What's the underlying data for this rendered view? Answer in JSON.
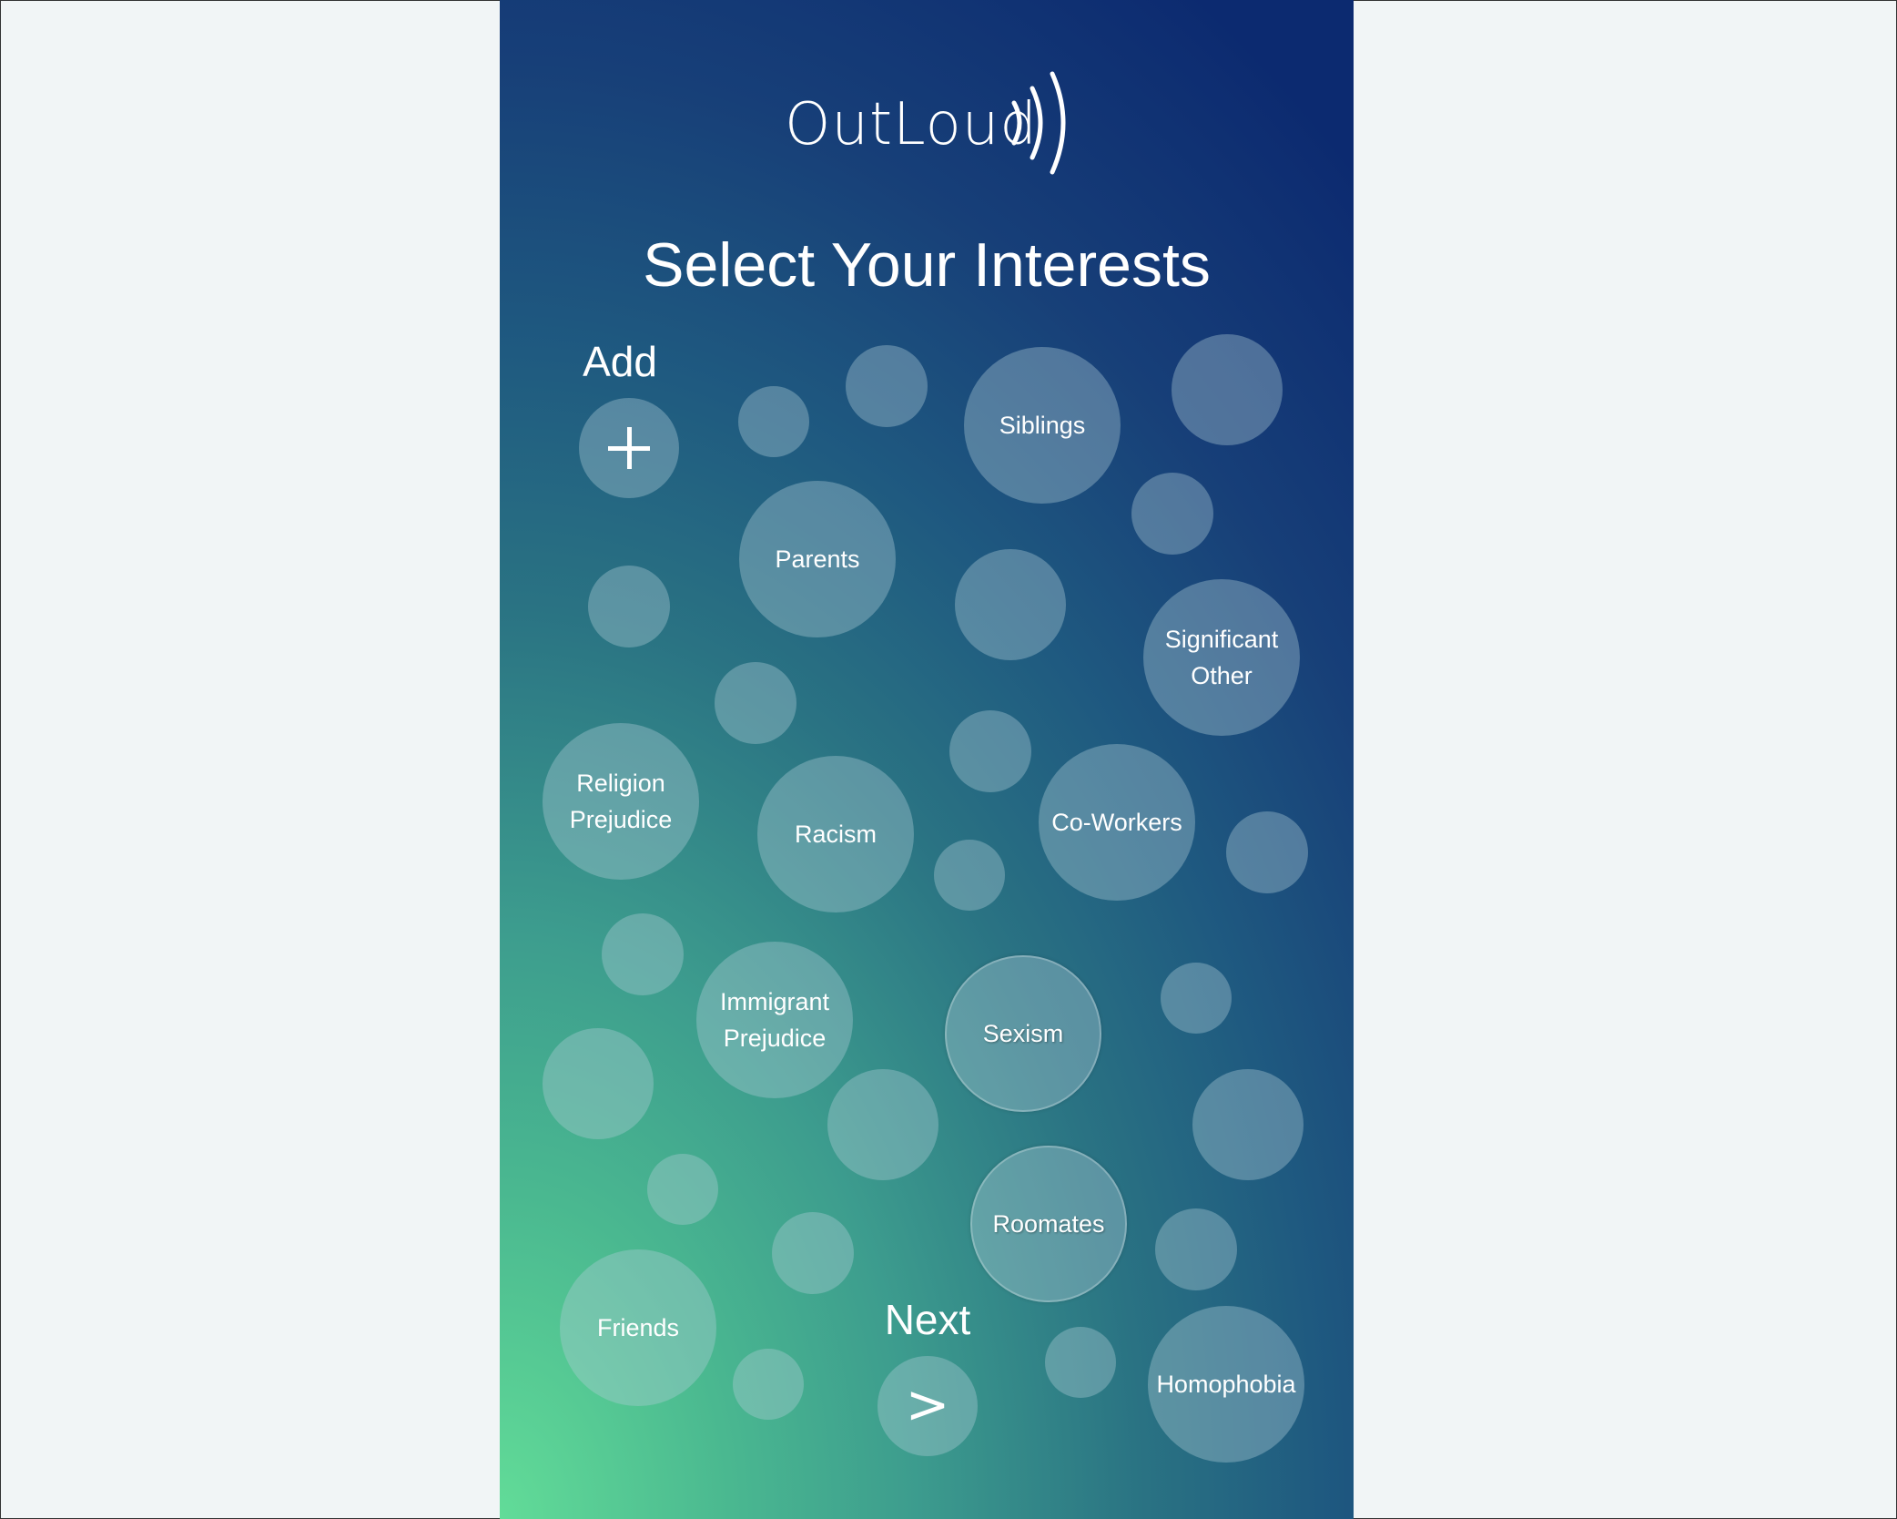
{
  "app": {
    "logo_text": "OutLoud",
    "title": "Select Your Interests"
  },
  "controls": {
    "add_label": "Add",
    "next_label": "Next",
    "next_symbol": ">"
  },
  "interests": {
    "siblings": "Siblings",
    "parents": "Parents",
    "significant_other_1": "Significant",
    "significant_other_2": "Other",
    "religion_1": "Religion",
    "religion_2": "Prejudice",
    "racism": "Racism",
    "coworkers": "Co-Workers",
    "immigrant_1": "Immigrant",
    "immigrant_2": "Prejudice",
    "sexism": "Sexism",
    "roomates": "Roomates",
    "friends": "Friends",
    "homophobia": "Homophobia"
  }
}
